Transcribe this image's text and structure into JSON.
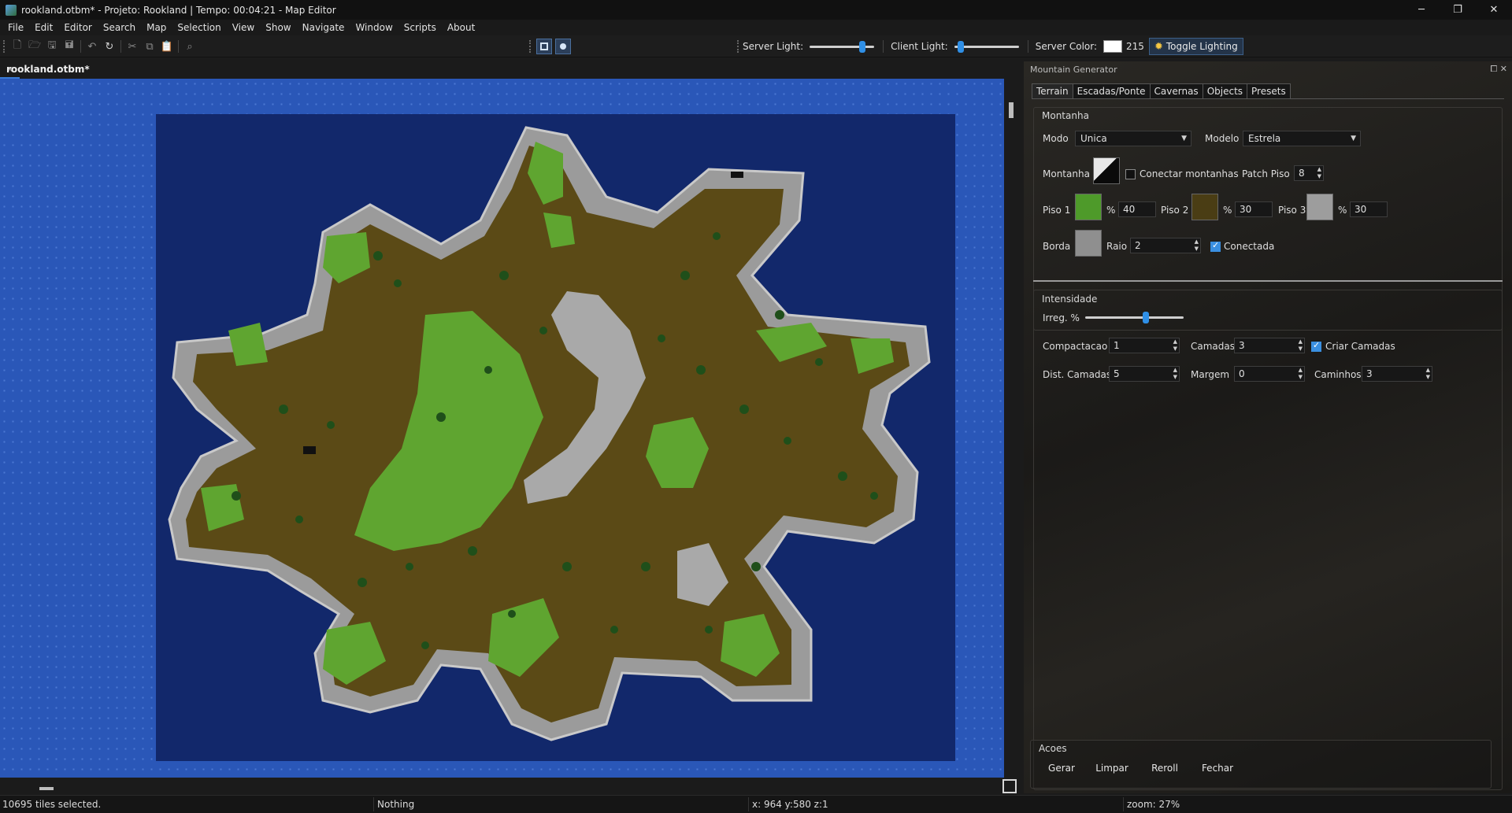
{
  "window": {
    "title": "rookland.otbm* - Projeto: Rookland | Tempo: 00:04:21 - Map Editor",
    "minimize": "─",
    "maximize": "❐",
    "close": "✕"
  },
  "menu": [
    "File",
    "Edit",
    "Editor",
    "Search",
    "Map",
    "Selection",
    "View",
    "Show",
    "Navigate",
    "Window",
    "Scripts",
    "About"
  ],
  "toolbar": {
    "icons": [
      "new-file-icon",
      "open-folder-icon",
      "save-icon",
      "save-all-icon",
      "undo-icon",
      "redo-icon",
      "cut-icon",
      "copy-icon",
      "paste-icon",
      "search-icon"
    ],
    "server_light_label": "Server Light:",
    "server_light_level": 0.85,
    "client_light_label": "Client Light:",
    "client_light_level": 0.05,
    "server_color_label": "Server Color:",
    "server_color_value": "215",
    "server_color_hex": "#ffffff",
    "toggle_lighting_label": "Toggle Lighting"
  },
  "document": {
    "tab_label": "rookland.otbm*",
    "tab_close": "✕"
  },
  "map": {
    "colors": {
      "ocean": "#2a57b8",
      "deep": "#12286b",
      "stone": "#9a9a9a",
      "dirt": "#5b4a16",
      "grass": "#5fa530",
      "tree": "#1f4f1a"
    }
  },
  "panel": {
    "title": "Mountain Generator",
    "tabs": [
      "Terrain",
      "Escadas/Ponte",
      "Cavernas",
      "Objects",
      "Presets"
    ],
    "active_tab": "Terrain",
    "montanha": {
      "group_title": "Montanha",
      "modo_label": "Modo",
      "modo_value": "Unica",
      "modelo_label": "Modelo",
      "modelo_value": "Estrela",
      "montanha_label": "Montanha",
      "conectar_label": "Conectar montanhas",
      "conectar_checked": false,
      "patch_label": "Patch Piso",
      "patch_value": "8",
      "piso1_label": "Piso 1",
      "piso1_pct_label": "%",
      "piso1_pct": "40",
      "piso2_label": "Piso 2",
      "piso2_pct_label": "%",
      "piso2_pct": "30",
      "piso3_label": "Piso 3",
      "piso3_pct_label": "%",
      "piso3_pct": "30",
      "borda_label": "Borda",
      "raio_label": "Raio",
      "raio_value": "2",
      "conectada_label": "Conectada",
      "conectada_checked": true
    },
    "intensidade": {
      "group_title": "Intensidade",
      "irreg_label": "Irreg. %",
      "irreg_level": 0.62,
      "compactacao_label": "Compactacao",
      "compactacao_value": "1",
      "camadas_label": "Camadas",
      "camadas_value": "3",
      "criar_camadas_label": "Criar Camadas",
      "criar_camadas_checked": true,
      "dist_camadas_label": "Dist. Camadas",
      "dist_camadas_value": "5",
      "margem_label": "Margem",
      "margem_value": "0",
      "caminhos_label": "Caminhos",
      "caminhos_value": "3"
    },
    "acoes": {
      "group_title": "Acoes",
      "buttons": [
        "Gerar",
        "Limpar",
        "Reroll",
        "Fechar"
      ]
    }
  },
  "status": {
    "selection": "10695 tiles selected.",
    "item": "Nothing",
    "position": "x: 964 y:580 z:1",
    "zoom": "zoom: 27%"
  }
}
